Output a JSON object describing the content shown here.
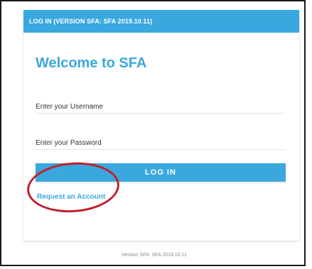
{
  "header": {
    "title": "LOG IN (VERSION SFA: SFA 2019.10.11)"
  },
  "main": {
    "heading": "Welcome to SFA",
    "username_placeholder": "Enter your Username",
    "password_placeholder": "Enter your Password",
    "login_label": "LOG IN",
    "request_account_label": "Request an Account"
  },
  "footer": {
    "version_text": "Version SFA: SFA 2019.10.11"
  },
  "colors": {
    "accent": "#3aa8de",
    "annotation": "#c0202c"
  }
}
